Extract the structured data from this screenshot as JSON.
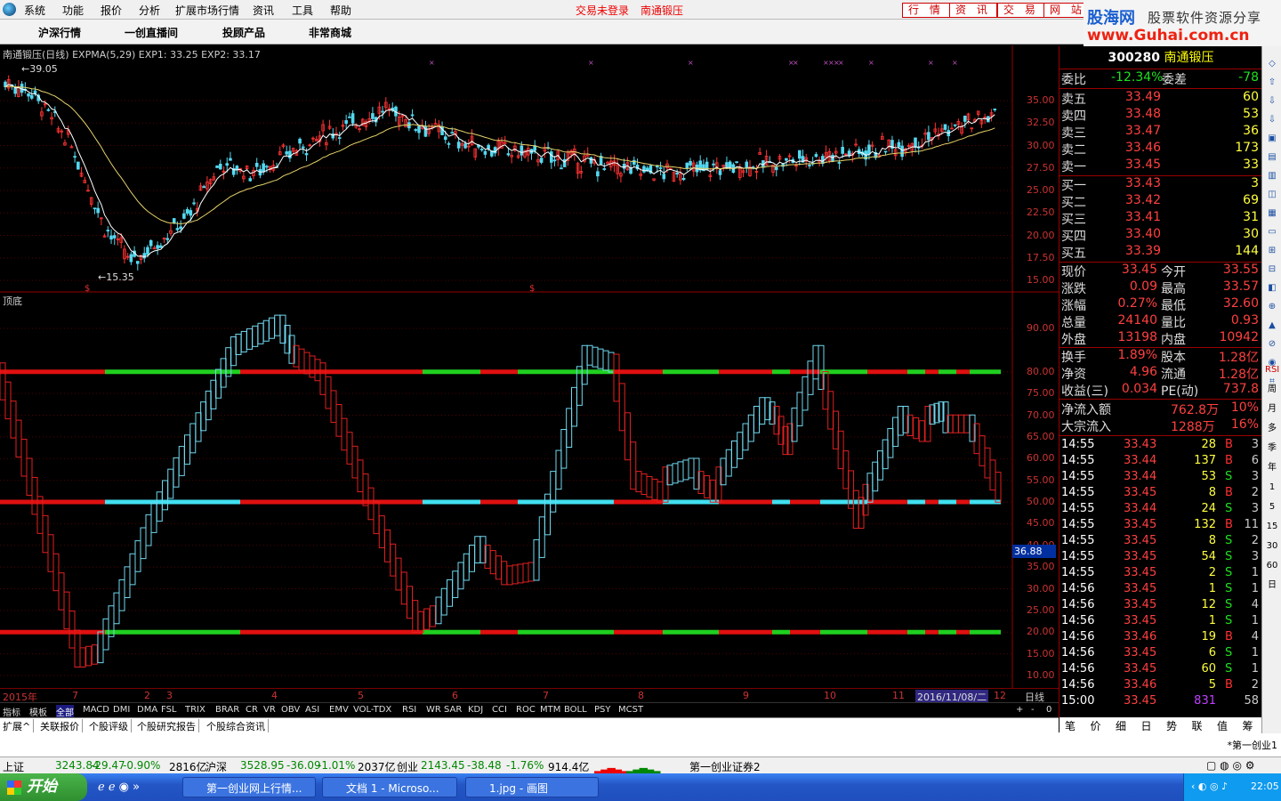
{
  "menu": {
    "items": [
      "系统",
      "功能",
      "报价",
      "分析",
      "扩展市场行情",
      "资讯",
      "工具",
      "帮助"
    ],
    "notice": "交易未登录",
    "stock_name": "南通锻压",
    "right_buttons": [
      "行 情",
      "资 讯",
      "交 易",
      "网 站"
    ]
  },
  "brand": {
    "name": "股海网",
    "slogan": "股票软件资源分享",
    "url": "www.Guhai.com.cn"
  },
  "nav": {
    "items": [
      "沪深行情",
      "一创直播间",
      "投顾产品",
      "非常商城"
    ]
  },
  "main_chart": {
    "header": "南通锻压(日线) EXPMA(5,29) EXP1: 33.25 EXP2: 33.17",
    "high_label": "39.05",
    "low_label": "15.35",
    "y_ticks": [
      "35.00",
      "32.50",
      "30.00",
      "27.50",
      "25.00",
      "22.50",
      "20.00",
      "17.50",
      "15.00"
    ]
  },
  "sub_chart": {
    "title": "顶底",
    "y_ticks": [
      "90.00",
      "80.00",
      "75.00",
      "70.00",
      "65.00",
      "60.00",
      "55.00",
      "50.00",
      "45.00",
      "40.00",
      "35.00",
      "30.00",
      "25.00",
      "20.00",
      "15.00",
      "10.00"
    ],
    "current_value": "36.88"
  },
  "time_axis": {
    "labels": [
      "2015年",
      "7",
      "2",
      "3",
      "4",
      "5",
      "6",
      "7",
      "8",
      "9",
      "10",
      "11",
      "12"
    ],
    "cursor_date": "2016/11/08/二",
    "period": "日线"
  },
  "indicator_tabs": [
    "指标",
    "模板",
    "全部",
    "MACD",
    "DMI",
    "DMA",
    "FSL",
    "TRIX",
    "BRAR",
    "CR",
    "VR",
    "OBV",
    "ASI",
    "EMV",
    "VOL-TDX",
    "RSI",
    "WR",
    "SAR",
    "KDJ",
    "CCI",
    "ROC",
    "MTM",
    "BOLL",
    "PSY",
    "MCST"
  ],
  "indicator_controls": [
    "+",
    "-",
    "0"
  ],
  "ext_tabs": [
    "扩展^",
    "关联报价",
    "个股评级",
    "个股研究报告",
    "个股综合资讯"
  ],
  "quote": {
    "code": "300280",
    "name": "南通锻压",
    "weibi_label": "委比",
    "weibi": "-12.34%",
    "weicha_label": "委差",
    "weicha": "-78",
    "sells": [
      {
        "label": "卖五",
        "price": "33.49",
        "vol": "60"
      },
      {
        "label": "卖四",
        "price": "33.48",
        "vol": "53"
      },
      {
        "label": "卖三",
        "price": "33.47",
        "vol": "36"
      },
      {
        "label": "卖二",
        "price": "33.46",
        "vol": "173"
      },
      {
        "label": "卖一",
        "price": "33.45",
        "vol": "33"
      }
    ],
    "buys": [
      {
        "label": "买一",
        "price": "33.43",
        "vol": "3"
      },
      {
        "label": "买二",
        "price": "33.42",
        "vol": "69"
      },
      {
        "label": "买三",
        "price": "33.41",
        "vol": "31"
      },
      {
        "label": "买四",
        "price": "33.40",
        "vol": "30"
      },
      {
        "label": "买五",
        "price": "33.39",
        "vol": "144"
      }
    ],
    "stats": [
      {
        "l1": "现价",
        "v1": "33.45",
        "l2": "今开",
        "v2": "33.55"
      },
      {
        "l1": "涨跌",
        "v1": "0.09",
        "l2": "最高",
        "v2": "33.57"
      },
      {
        "l1": "涨幅",
        "v1": "0.27%",
        "l2": "最低",
        "v2": "32.60"
      },
      {
        "l1": "总量",
        "v1": "24140",
        "l2": "量比",
        "v2": "0.93"
      },
      {
        "l1": "外盘",
        "v1": "13198",
        "l2": "内盘",
        "v2": "10942"
      }
    ],
    "stats2": [
      {
        "l1": "换手",
        "v1": "1.89%",
        "l2": "股本",
        "v2": "1.28亿"
      },
      {
        "l1": "净资",
        "v1": "4.96",
        "l2": "流通",
        "v2": "1.28亿"
      },
      {
        "l1": "收益(三)",
        "v1": "0.034",
        "l2": "PE(动)",
        "v2": "737.8"
      }
    ],
    "flows": [
      {
        "label": "净流入额",
        "value": "762.8万",
        "pct": "10%"
      },
      {
        "label": "大宗流入",
        "value": "1288万",
        "pct": "16%"
      }
    ]
  },
  "ticks": [
    {
      "t": "14:55",
      "p": "33.43",
      "v": "28",
      "s": "B",
      "n": "3"
    },
    {
      "t": "14:55",
      "p": "33.44",
      "v": "137",
      "s": "B",
      "n": "6"
    },
    {
      "t": "14:55",
      "p": "33.44",
      "v": "53",
      "s": "S",
      "n": "3"
    },
    {
      "t": "14:55",
      "p": "33.45",
      "v": "8",
      "s": "B",
      "n": "2"
    },
    {
      "t": "14:55",
      "p": "33.44",
      "v": "24",
      "s": "S",
      "n": "3"
    },
    {
      "t": "14:55",
      "p": "33.45",
      "v": "132",
      "s": "B",
      "n": "11"
    },
    {
      "t": "14:55",
      "p": "33.45",
      "v": "8",
      "s": "S",
      "n": "2"
    },
    {
      "t": "14:55",
      "p": "33.45",
      "v": "54",
      "s": "S",
      "n": "3"
    },
    {
      "t": "14:55",
      "p": "33.45",
      "v": "2",
      "s": "S",
      "n": "1"
    },
    {
      "t": "14:56",
      "p": "33.45",
      "v": "1",
      "s": "S",
      "n": "1"
    },
    {
      "t": "14:56",
      "p": "33.45",
      "v": "12",
      "s": "S",
      "n": "4"
    },
    {
      "t": "14:56",
      "p": "33.45",
      "v": "1",
      "s": "S",
      "n": "1"
    },
    {
      "t": "14:56",
      "p": "33.46",
      "v": "19",
      "s": "B",
      "n": "4"
    },
    {
      "t": "14:56",
      "p": "33.45",
      "v": "6",
      "s": "S",
      "n": "1"
    },
    {
      "t": "14:56",
      "p": "33.45",
      "v": "60",
      "s": "S",
      "n": "1"
    },
    {
      "t": "14:56",
      "p": "33.46",
      "v": "5",
      "s": "B",
      "n": "2"
    },
    {
      "t": "15:00",
      "p": "33.45",
      "v": "831",
      "s": "",
      "n": "58"
    }
  ],
  "right_tabs": [
    "笔",
    "价",
    "细",
    "日",
    "势",
    "联",
    "值",
    "筹"
  ],
  "right_tools": [
    "RSI",
    "周",
    "月",
    "多",
    "季",
    "年",
    "1",
    "5",
    "15",
    "30",
    "60",
    "日"
  ],
  "bottom_right": "*第一创业1",
  "index_bar": [
    {
      "name": "上证",
      "val": "3243.84",
      "chg": "-29.47",
      "pct": "-0.90%",
      "amt": "2816亿"
    },
    {
      "name": "沪深",
      "val": "3528.95",
      "chg": "-36.09",
      "pct": "-1.01%",
      "amt": "2037亿"
    },
    {
      "name": "创业",
      "val": "2143.45",
      "chg": "-38.48",
      "pct": "-1.76%",
      "amt": "914.4亿"
    }
  ],
  "broker": "第一创业证券2",
  "taskbar": {
    "start": "开始",
    "windows": [
      "第一创业网上行情...",
      "文档 1 - Microso...",
      "1.jpg - 画图"
    ],
    "clock": "22:05"
  },
  "colors": {
    "up": "#ff3333",
    "down": "#54d8f0",
    "ma1": "#ffffff",
    "ma2": "#e6d36a",
    "line_red": "#e01010",
    "line_green": "#20d020",
    "line_cyan": "#40e0f0"
  }
}
